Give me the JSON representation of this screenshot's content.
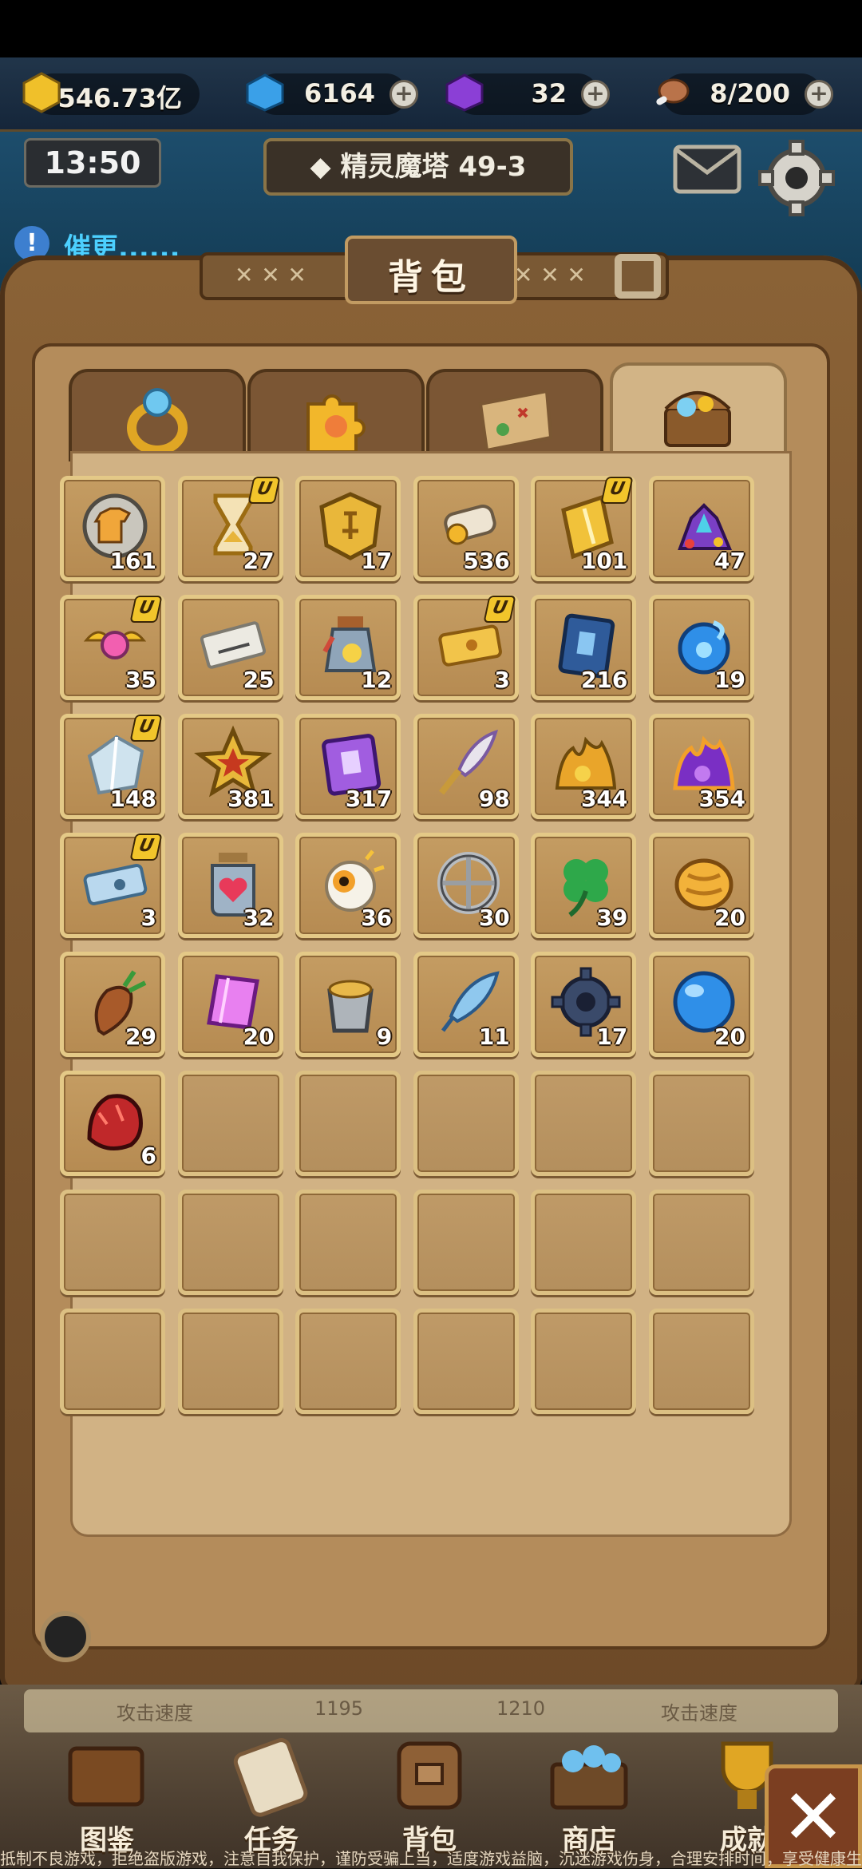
{
  "header": {
    "gold": "546.73亿",
    "gems": "6164",
    "crystals": "32",
    "stamina": "8/200",
    "time": "13:50",
    "stage": "◆ 精灵魔塔 49-3",
    "tip": "催更......",
    "plus": "+",
    "tip_icon": "!"
  },
  "bag": {
    "title": "背包",
    "tabs": [
      "ring-tab",
      "puzzle-tab",
      "map-tab",
      "chest-tab"
    ],
    "active_tab": 3,
    "items": [
      {
        "name": "armor-coin",
        "count": "161",
        "u": false,
        "icon": "coin-shirt-icon"
      },
      {
        "name": "hourglass",
        "count": "27",
        "u": true,
        "icon": "hourglass-icon"
      },
      {
        "name": "gold-rune",
        "count": "17",
        "u": false,
        "icon": "gold-rune-icon"
      },
      {
        "name": "scroll",
        "count": "536",
        "u": false,
        "icon": "scroll-icon"
      },
      {
        "name": "gold-ticket",
        "count": "101",
        "u": true,
        "icon": "gold-card-icon"
      },
      {
        "name": "gem-pile",
        "count": "47",
        "u": false,
        "icon": "gem-pile-icon"
      },
      {
        "name": "winged-orb",
        "count": "35",
        "u": true,
        "icon": "winged-orb-icon"
      },
      {
        "name": "coupon",
        "count": "25",
        "u": false,
        "icon": "coupon-icon"
      },
      {
        "name": "bottle",
        "count": "12",
        "u": false,
        "icon": "bottle-icon"
      },
      {
        "name": "ticket",
        "count": "3",
        "u": true,
        "icon": "ticket-icon"
      },
      {
        "name": "blue-book",
        "count": "216",
        "u": false,
        "icon": "blue-book-icon"
      },
      {
        "name": "blue-orb",
        "count": "19",
        "u": false,
        "icon": "blue-swirl-icon"
      },
      {
        "name": "crystal-shard",
        "count": "148",
        "u": true,
        "icon": "crystal-icon"
      },
      {
        "name": "star-badge",
        "count": "381",
        "u": false,
        "icon": "star-badge-icon"
      },
      {
        "name": "purple-book",
        "count": "317",
        "u": false,
        "icon": "purple-book-icon"
      },
      {
        "name": "feather-sword",
        "count": "98",
        "u": false,
        "icon": "feather-sword-icon"
      },
      {
        "name": "gold-ore",
        "count": "344",
        "u": false,
        "icon": "gold-ore-icon"
      },
      {
        "name": "purple-ore",
        "count": "354",
        "u": false,
        "icon": "purple-ore-icon"
      },
      {
        "name": "blue-ticket",
        "count": "3",
        "u": true,
        "icon": "blue-ticket-icon"
      },
      {
        "name": "heart-jar",
        "count": "32",
        "u": false,
        "icon": "heart-jar-icon"
      },
      {
        "name": "eye-orb",
        "count": "36",
        "u": false,
        "icon": "eye-orb-icon"
      },
      {
        "name": "wheel",
        "count": "30",
        "u": false,
        "icon": "wheel-icon"
      },
      {
        "name": "clover",
        "count": "39",
        "u": false,
        "icon": "clover-icon"
      },
      {
        "name": "walnut",
        "count": "20",
        "u": false,
        "icon": "walnut-icon"
      },
      {
        "name": "root",
        "count": "29",
        "u": false,
        "icon": "root-icon"
      },
      {
        "name": "pink-crystal",
        "count": "20",
        "u": false,
        "icon": "pink-crystal-icon"
      },
      {
        "name": "bucket",
        "count": "9",
        "u": false,
        "icon": "bucket-icon"
      },
      {
        "name": "blue-feather",
        "count": "11",
        "u": false,
        "icon": "blue-feather-icon"
      },
      {
        "name": "dark-gear",
        "count": "17",
        "u": false,
        "icon": "gear-item-icon"
      },
      {
        "name": "blue-ball",
        "count": "20",
        "u": false,
        "icon": "blue-ball-icon"
      },
      {
        "name": "red-ore",
        "count": "6",
        "u": false,
        "icon": "red-ore-icon"
      }
    ],
    "empty_slots": 17
  },
  "bottom": {
    "stats": [
      "攻击速度",
      "1195",
      "1210",
      "攻击速度"
    ],
    "nav": [
      "图鉴",
      "任务",
      "背包",
      "商店",
      "成就"
    ],
    "close": "✕",
    "footer": "抵制不良游戏，拒绝盗版游戏，注意自我保护，谨防受骗上当，适度游戏益脑，沉迷游戏伤身，合理安排时间，享受健康生活"
  },
  "colors": {
    "accent_gold": "#e4c987",
    "frame_brown": "#7b5634",
    "parchment": "#d1b284"
  }
}
